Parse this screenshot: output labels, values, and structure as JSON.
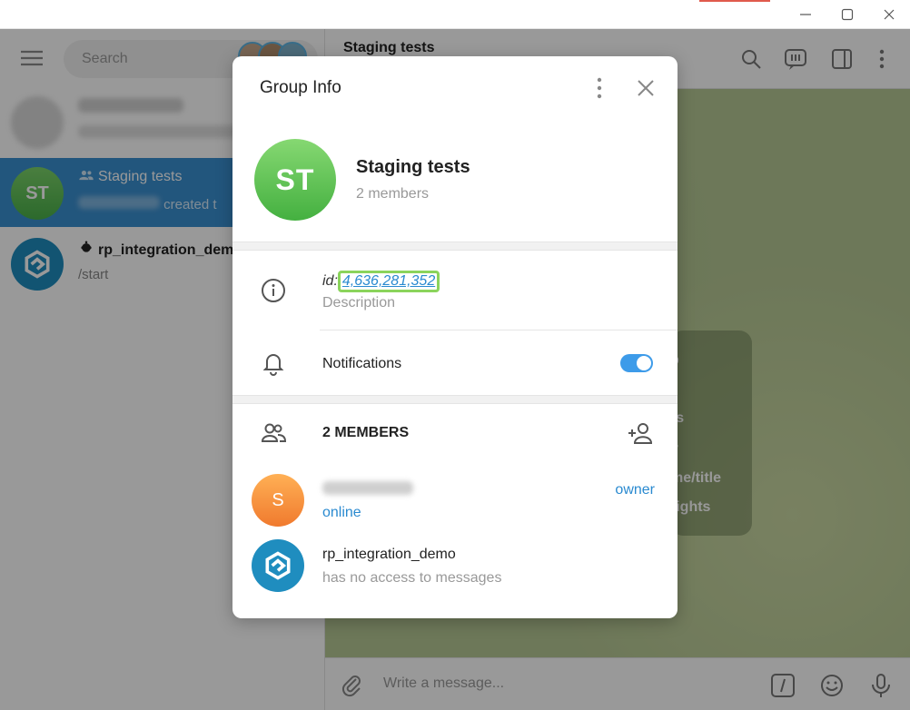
{
  "window": {
    "controls": [
      "minimize-icon",
      "maximize-icon",
      "close-icon"
    ]
  },
  "sidebar": {
    "search_placeholder": "Search",
    "chats": [
      {
        "name": "",
        "preview": "",
        "blurred": true
      },
      {
        "avatar_initials": "ST",
        "name": "Staging tests",
        "preview_suffix": "created t",
        "group_icon": "group-icon",
        "selected": true
      },
      {
        "name": "rp_integration_demo",
        "preview": "/start",
        "bot_icon": "bot-icon"
      }
    ]
  },
  "main": {
    "title": "Staging tests",
    "service_lines": [
      "p",
      "rs",
      "y",
      "me/title",
      "rights"
    ],
    "composer_placeholder": "Write a message..."
  },
  "modal": {
    "title": "Group Info",
    "avatar_initials": "ST",
    "group_name": "Staging tests",
    "member_count": "2 members",
    "id_prefix": "id:",
    "id_value": "4,636,281,352",
    "description": "Description",
    "notifications_label": "Notifications",
    "notifications_on": true,
    "members_heading": "2 MEMBERS",
    "members": [
      {
        "avatar_initial": "S",
        "name": "",
        "name_blurred": true,
        "status": "online",
        "role": "owner"
      },
      {
        "name": "rp_integration_demo",
        "status": "has no access to messages",
        "role": ""
      }
    ]
  },
  "colors": {
    "accent": "#2a8ad0",
    "selected_chat": "#3a8fd0",
    "highlight_box": "#8bd45c",
    "toggle_on": "#3d9be9"
  }
}
